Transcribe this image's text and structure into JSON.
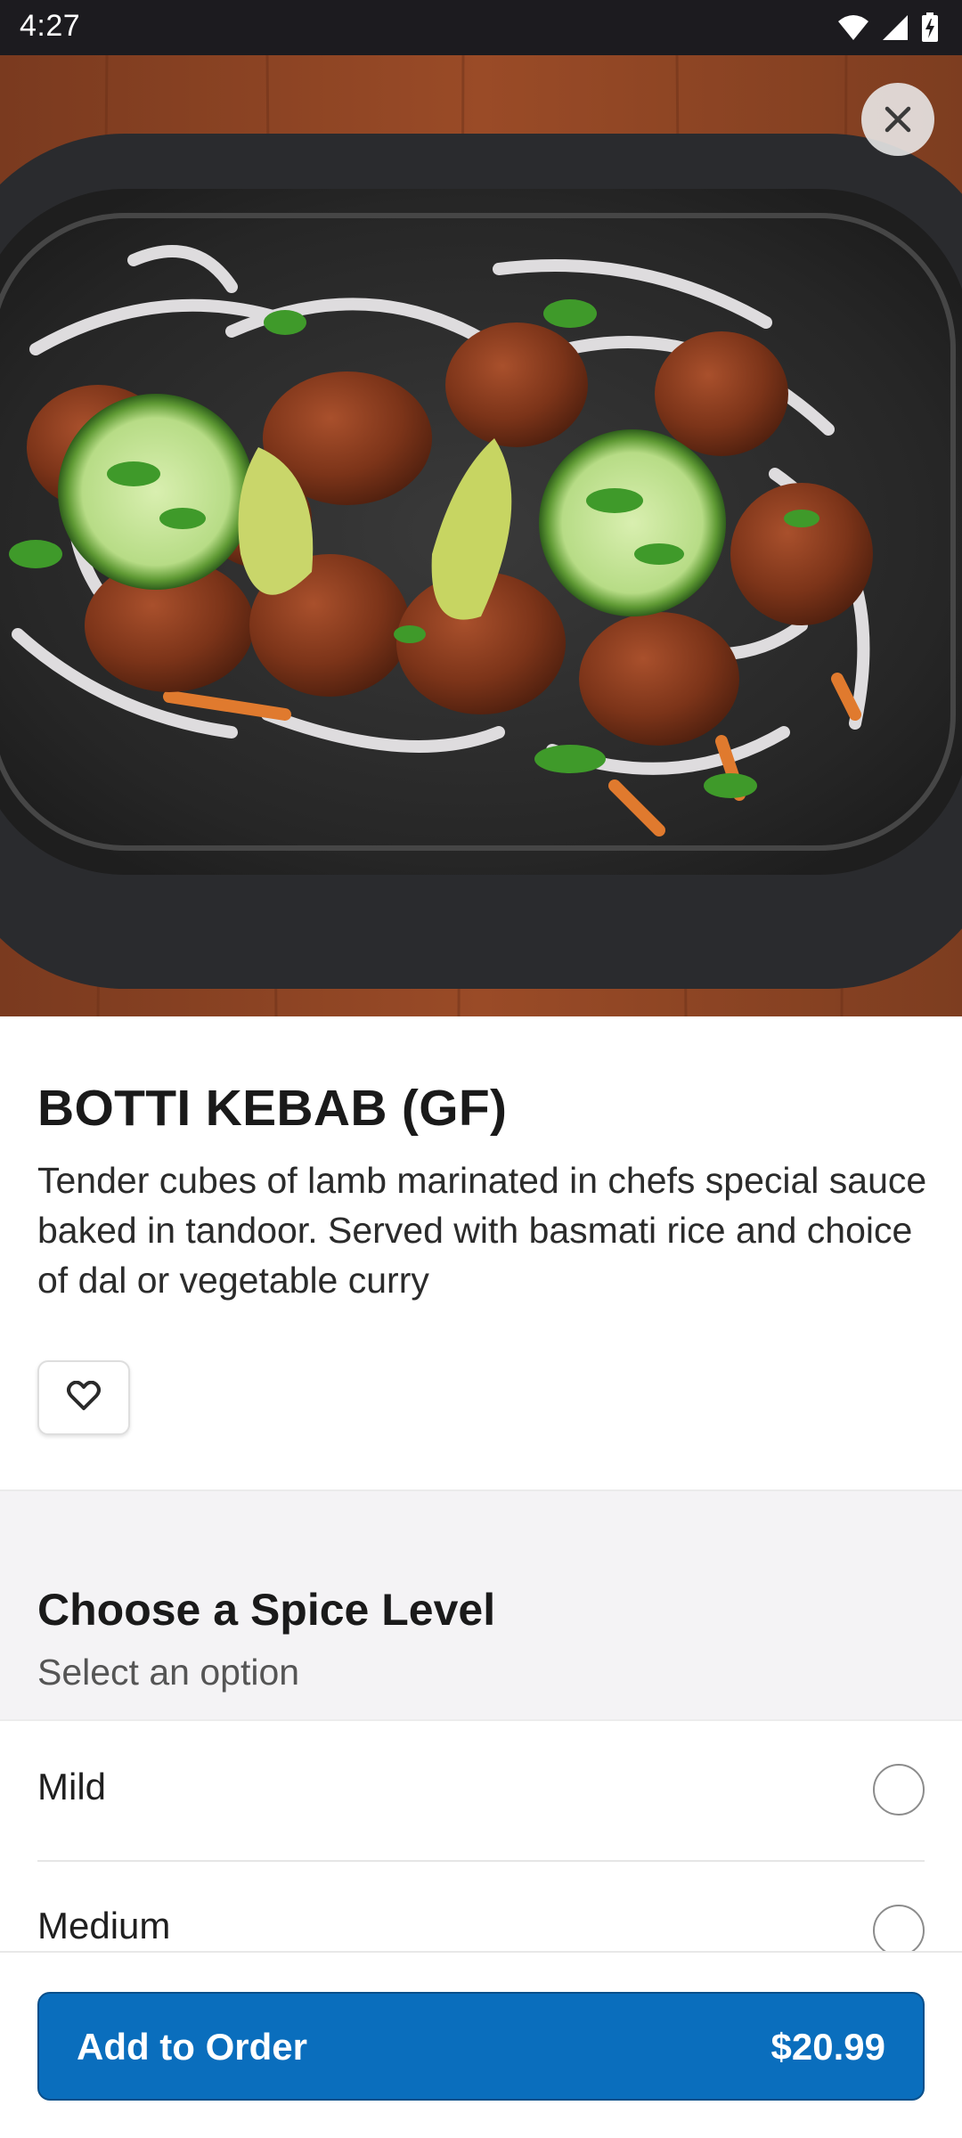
{
  "status_bar": {
    "time": "4:27",
    "icons": [
      "wifi-icon",
      "cellular-signal-icon",
      "battery-charging-icon"
    ]
  },
  "hero": {
    "image": "botti-kebab-photo",
    "close_icon": "close-icon"
  },
  "item": {
    "title": "BOTTI KEBAB (GF)",
    "description": "Tender cubes of lamb marinated in chefs special sauce baked in tandoor. Served with basmati rice and choice of dal or vegetable curry",
    "favorite_icon": "heart-outline-icon"
  },
  "spice_section": {
    "title": "Choose a Spice Level",
    "subtitle": "Select an option",
    "options": [
      {
        "label": "Mild",
        "selected": false
      },
      {
        "label": "Medium",
        "selected": false
      }
    ]
  },
  "order": {
    "button_label": "Add to Order",
    "price": "$20.99"
  },
  "colors": {
    "primary": "#0a6ebd",
    "status_bar": "#1c1b1f",
    "section_bg": "#f4f3f5"
  }
}
